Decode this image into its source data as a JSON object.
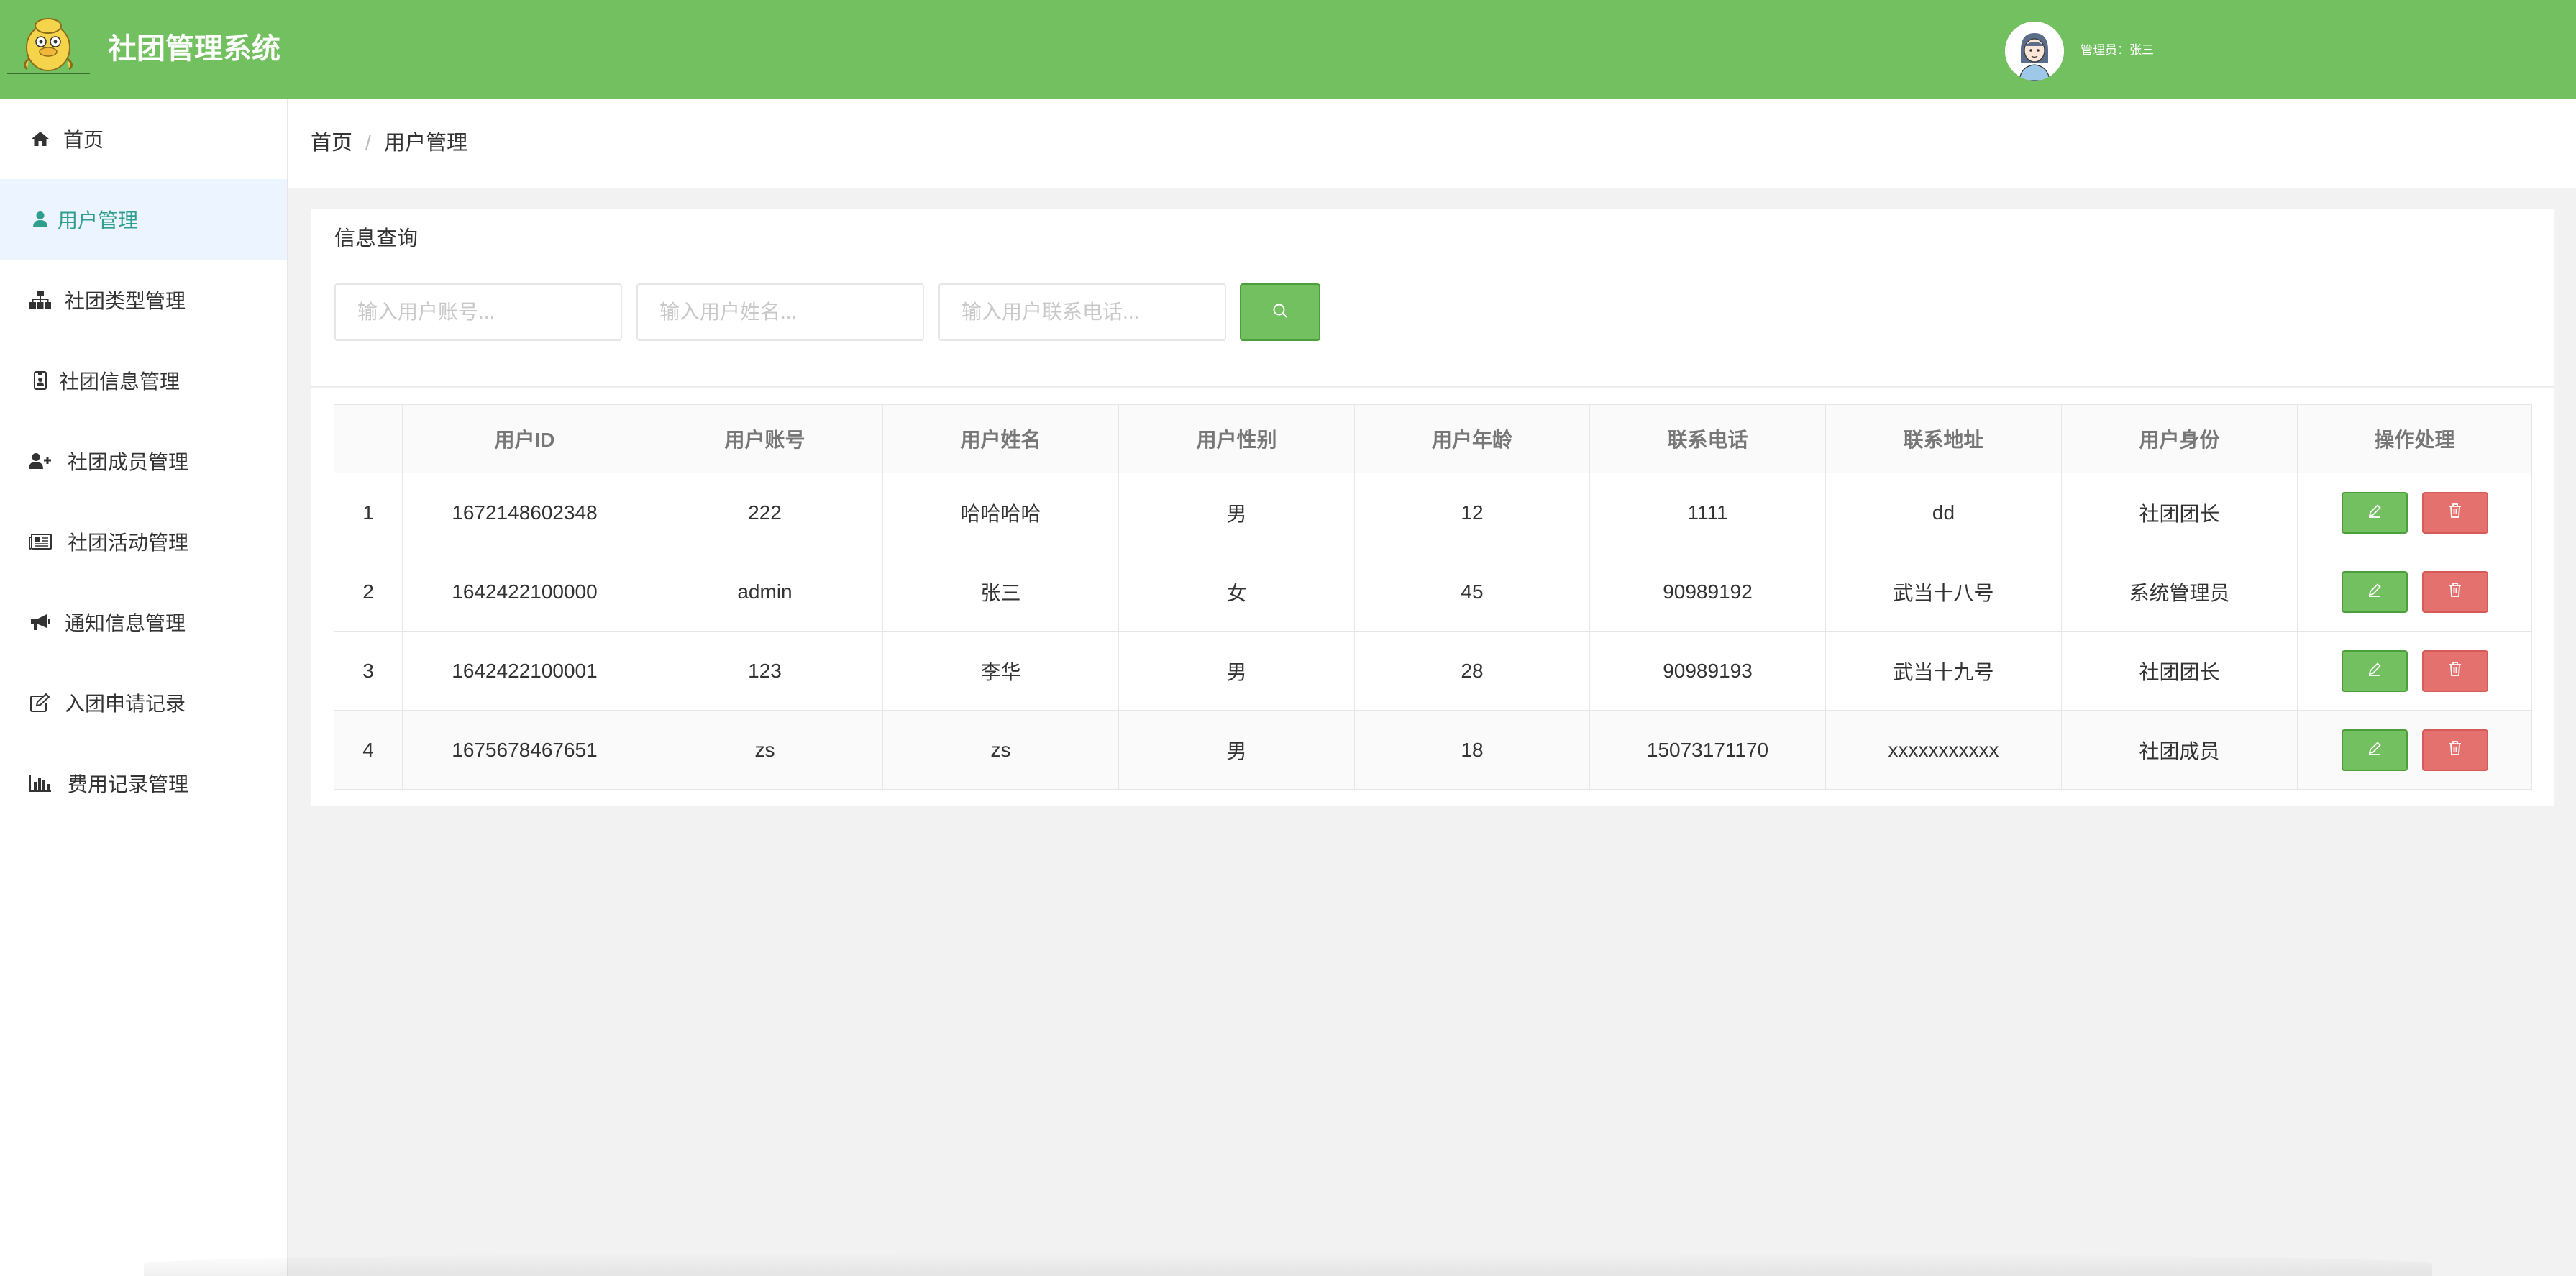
{
  "header": {
    "app_title": "社团管理系统",
    "admin_label": "管理员：张三",
    "brand_color": "#72c05f",
    "logo_icon": "cartoon-duck-logo",
    "avatar_icon": "avatar-girl-icon"
  },
  "sidebar": {
    "active_color": "#2f9e8f",
    "active_bg": "#ecf5ff",
    "items": [
      {
        "label": "首页",
        "icon": "home-icon"
      },
      {
        "label": "用户管理",
        "icon": "user-icon"
      },
      {
        "label": "社团类型管理",
        "icon": "sitemap-icon"
      },
      {
        "label": "社团信息管理",
        "icon": "id-badge-icon"
      },
      {
        "label": "社团成员管理",
        "icon": "user-plus-icon"
      },
      {
        "label": "社团活动管理",
        "icon": "newspaper-icon"
      },
      {
        "label": "通知信息管理",
        "icon": "bullhorn-icon"
      },
      {
        "label": "入团申请记录",
        "icon": "edit-icon"
      },
      {
        "label": "费用记录管理",
        "icon": "bar-chart-icon"
      }
    ]
  },
  "breadcrumb": {
    "home": "首页",
    "separator": "/",
    "current": "用户管理"
  },
  "search": {
    "title": "信息查询",
    "account_placeholder": "输入用户账号...",
    "name_placeholder": "输入用户姓名...",
    "phone_placeholder": "输入用户联系电话...",
    "button_icon": "search-icon"
  },
  "table": {
    "headers": [
      "",
      "用户ID",
      "用户账号",
      "用户姓名",
      "用户性别",
      "用户年龄",
      "联系电话",
      "联系地址",
      "用户身份",
      "操作处理"
    ],
    "rows": [
      {
        "index": "1",
        "id": "1672148602348",
        "account": "222",
        "name": "哈哈哈哈",
        "gender": "男",
        "age": "12",
        "phone": "1111",
        "address": "dd",
        "role": "社团团长"
      },
      {
        "index": "2",
        "id": "1642422100000",
        "account": "admin",
        "name": "张三",
        "gender": "女",
        "age": "45",
        "phone": "90989192",
        "address": "武当十八号",
        "role": "系统管理员"
      },
      {
        "index": "3",
        "id": "1642422100001",
        "account": "123",
        "name": "李华",
        "gender": "男",
        "age": "28",
        "phone": "90989193",
        "address": "武当十九号",
        "role": "社团团长"
      },
      {
        "index": "4",
        "id": "1675678467651",
        "account": "zs",
        "name": "zs",
        "gender": "男",
        "age": "18",
        "phone": "15073171170",
        "address": "xxxxxxxxxxx",
        "role": "社团成员"
      }
    ],
    "edit_icon": "pencil-icon",
    "delete_icon": "trash-icon",
    "edit_color": "#72c05f",
    "delete_color": "#e5716e"
  }
}
